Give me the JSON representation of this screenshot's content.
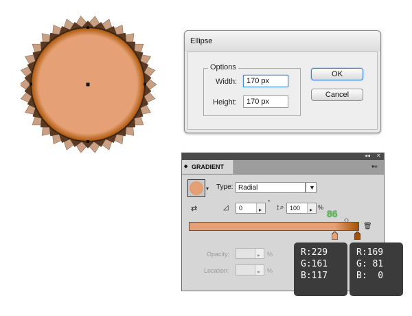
{
  "artboard": {
    "circle_fill_inner": "#e5a175",
    "circle_fill_outer": "#a95100",
    "scallop_colors": [
      "#c9a083",
      "#5a3a22"
    ]
  },
  "dialog": {
    "title": "Ellipse",
    "options_label": "Options",
    "width_label": "Width:",
    "width_value": "170 px",
    "height_label": "Height:",
    "height_value": "170 px",
    "ok_label": "OK",
    "cancel_label": "Cancel"
  },
  "gradient_panel": {
    "tab_label": "GRADIENT",
    "type_label": "Type:",
    "type_value": "Radial",
    "angle_value": "0",
    "degree_symbol": "°",
    "aspect_value": "100",
    "percent_symbol": "%",
    "midpoint_location": "86",
    "opacity_label": "Opacity:",
    "location_label": "Location:",
    "opacity_unit": "%",
    "location_unit": "%",
    "stops": [
      {
        "position_pct": 86,
        "color": "#e5a175"
      },
      {
        "position_pct": 100,
        "color": "#a95100"
      }
    ]
  },
  "color_tooltips": [
    {
      "r": "R:229",
      "g": "G:161",
      "b": "B:117"
    },
    {
      "r": "R:169",
      "g": "G: 81",
      "b": "B:  0"
    }
  ]
}
